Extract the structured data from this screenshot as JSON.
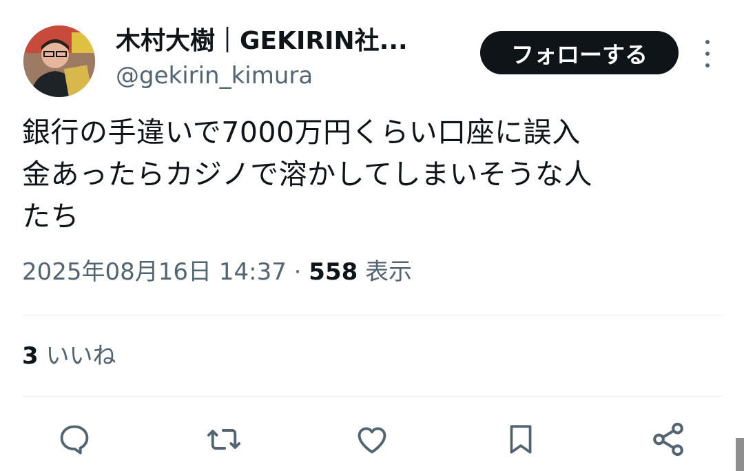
{
  "user": {
    "display_name": "木村大樹｜GEKIRIN社...",
    "handle": "@gekirin_kimura"
  },
  "follow_button_label": "フォローする",
  "tweet": {
    "text": "銀行の手違いで7000万円くらい口座に誤入\n金あったらカジノで溶かしてしまいそうな人\nたち",
    "timestamp": "2025年08月16日 14:37",
    "separator": " · ",
    "views_count": "558",
    "views_label": " 表示"
  },
  "engagement": {
    "likes_count": "3",
    "likes_label": " いいね"
  },
  "actions": [
    {
      "name": "reply",
      "icon": "reply-icon"
    },
    {
      "name": "retweet",
      "icon": "retweet-icon"
    },
    {
      "name": "like",
      "icon": "heart-icon"
    },
    {
      "name": "bookmark",
      "icon": "bookmark-icon"
    },
    {
      "name": "share",
      "icon": "share-icon"
    }
  ],
  "colors": {
    "text_primary": "#0f1419",
    "text_secondary": "#536471",
    "button_bg": "#0f1419",
    "divider": "#e6ecf0"
  }
}
